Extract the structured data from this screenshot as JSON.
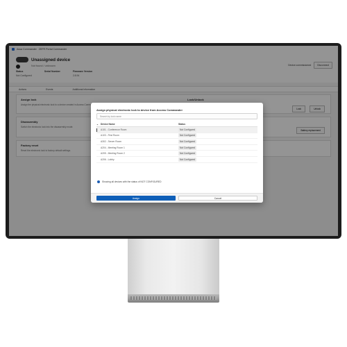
{
  "window": {
    "title": "Assa Commander",
    "subtitle": "ZEFR Portal Commander"
  },
  "device": {
    "title": "Unassigned device",
    "subtitle": "Not found / unknown",
    "primary_action": "Device commissioned",
    "secondary_action": "Disconnect"
  },
  "info": [
    {
      "label": "Status",
      "value": "Not Configured"
    },
    {
      "label": "Serial Number",
      "value": ""
    },
    {
      "label": "Firmware Version",
      "value": "2.8.94"
    }
  ],
  "tabs": [
    "Actions",
    "Events",
    "Additional information"
  ],
  "cards": [
    {
      "title": "Assign lock",
      "text": "Assign the physical electronic lock to a device created in Access Commander",
      "right_title": "Lock/Unlock",
      "buttons": [
        "Lock",
        "Unlock"
      ]
    },
    {
      "title": "Disassembly",
      "text": "Switch the electronic lock into the disassembly mode.",
      "buttons": [
        "Battery replacement"
      ]
    },
    {
      "title": "Factory reset",
      "text": "Reset the electronic lock to factory default settings.",
      "buttons": []
    }
  ],
  "dialog": {
    "title": "Assign physical electronic lock to device from Access Commander",
    "search_placeholder": "Search by lock name",
    "col_name": "Device Name",
    "col_status": "Status",
    "rows": [
      {
        "name": "A101 - Conference Room",
        "status": "Not Configured",
        "selected": true
      },
      {
        "name": "A103 - First Room",
        "status": "Not Configured"
      },
      {
        "name": "A302 - Server Room",
        "status": "Not Configured"
      },
      {
        "name": "A204 - Meeting Room 1",
        "status": "Not Configured"
      },
      {
        "name": "A205 - Meeting Room 2",
        "status": "Not Configured"
      },
      {
        "name": "A206 - Lobby",
        "status": "Not Configured"
      }
    ],
    "note": "Showing all devices with the status of NOT CONFIGURED",
    "assign_label": "Assign",
    "cancel_label": "Cancel"
  }
}
